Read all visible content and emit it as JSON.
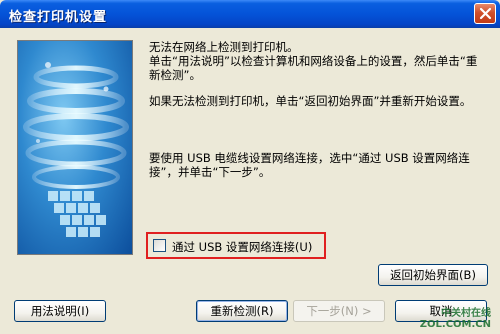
{
  "window": {
    "title": "检查打印机设置"
  },
  "messages": {
    "line1": "无法在网络上检测到打印机。\n单击“用法说明”以检查计算机和网络设备上的设置，然后单击“重新检测”。",
    "line2": "如果无法检测到打印机，单击“返回初始界面”并重新开始设置。",
    "line3": "要使用 USB 电缆线设置网络连接，选中“通过 USB 设置网络连接”，并单击“下一步”。"
  },
  "usb_option": {
    "label": "通过 USB 设置网络连接(U)",
    "checked": false
  },
  "buttons": {
    "return_initial": "返回初始界面(B)",
    "instructions": "用法说明(I)",
    "redetect": "重新检测(R)",
    "next": "下一步(N) >",
    "cancel": "取消"
  },
  "watermark": {
    "line1": "中关村在线",
    "line2": "ZOL.COM.CN"
  }
}
